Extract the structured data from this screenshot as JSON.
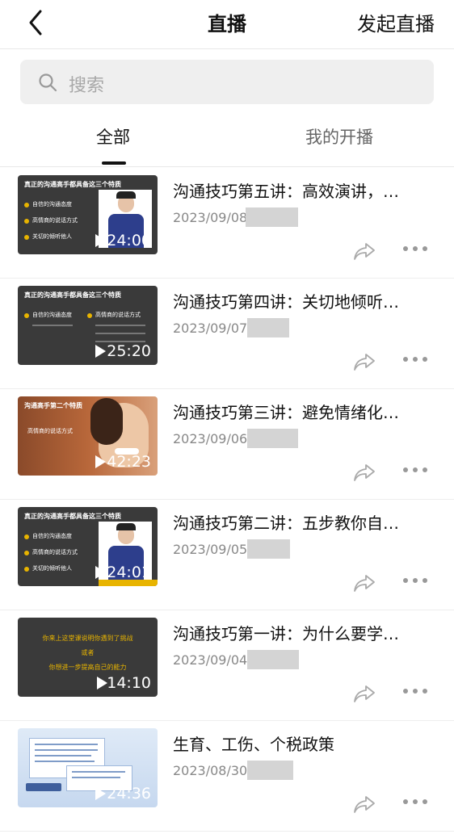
{
  "header": {
    "title": "直播",
    "action_label": "发起直播"
  },
  "search": {
    "placeholder": "搜索"
  },
  "tabs": [
    {
      "label": "全部",
      "active": true
    },
    {
      "label": "我的开播",
      "active": false
    }
  ],
  "videos": [
    {
      "title": "沟通技巧第五讲：高效演讲，…",
      "date": "2023/09/08",
      "duration": "24:00",
      "thumb_title": "真正的沟通高手都具备这三个特质",
      "thumb_lines": [
        "自信的沟通态度",
        "高情商的说话方式",
        "关切的倾听他人"
      ]
    },
    {
      "title": "沟通技巧第四讲：关切地倾听…",
      "date": "2023/09/07",
      "duration": "25:20",
      "thumb_title": "真正的沟通高手都具备这三个特质",
      "thumb_lines": [
        "自信的沟通态度",
        "高情商的说话方式"
      ]
    },
    {
      "title": "沟通技巧第三讲：避免情绪化…",
      "date": "2023/09/06",
      "duration": "42:23",
      "thumb_title": "沟通高手第二个特质",
      "thumb_lines": [
        "高情商的说话方式"
      ]
    },
    {
      "title": "沟通技巧第二讲：五步教你自…",
      "date": "2023/09/05",
      "duration": "24:01",
      "thumb_title": "真正的沟通高手都具备这三个特质",
      "thumb_lines": [
        "自信的沟通态度",
        "高情商的说话方式",
        "关切的倾听他人"
      ]
    },
    {
      "title": "沟通技巧第一讲：为什么要学…",
      "date": "2023/09/04",
      "duration": "14:10",
      "thumb_title": "你来上这堂课说明你遇到了挑战",
      "thumb_lines": [
        "或者",
        "你想进一步提高自己的能力"
      ]
    },
    {
      "title": "生育、工伤、个税政策",
      "date": "2023/08/30",
      "duration": "24:36",
      "thumb_title": "",
      "thumb_lines": []
    }
  ],
  "colors": {
    "accent": "#111111",
    "muted_text": "#888888",
    "search_bg": "#efefef",
    "dark_thumb": "#3a3a3a",
    "bullet_yellow": "#e8b400"
  },
  "icons": {
    "back": "chevron-left-icon",
    "search": "search-icon",
    "share": "share-icon",
    "more": "more-icon",
    "play": "play-icon"
  }
}
